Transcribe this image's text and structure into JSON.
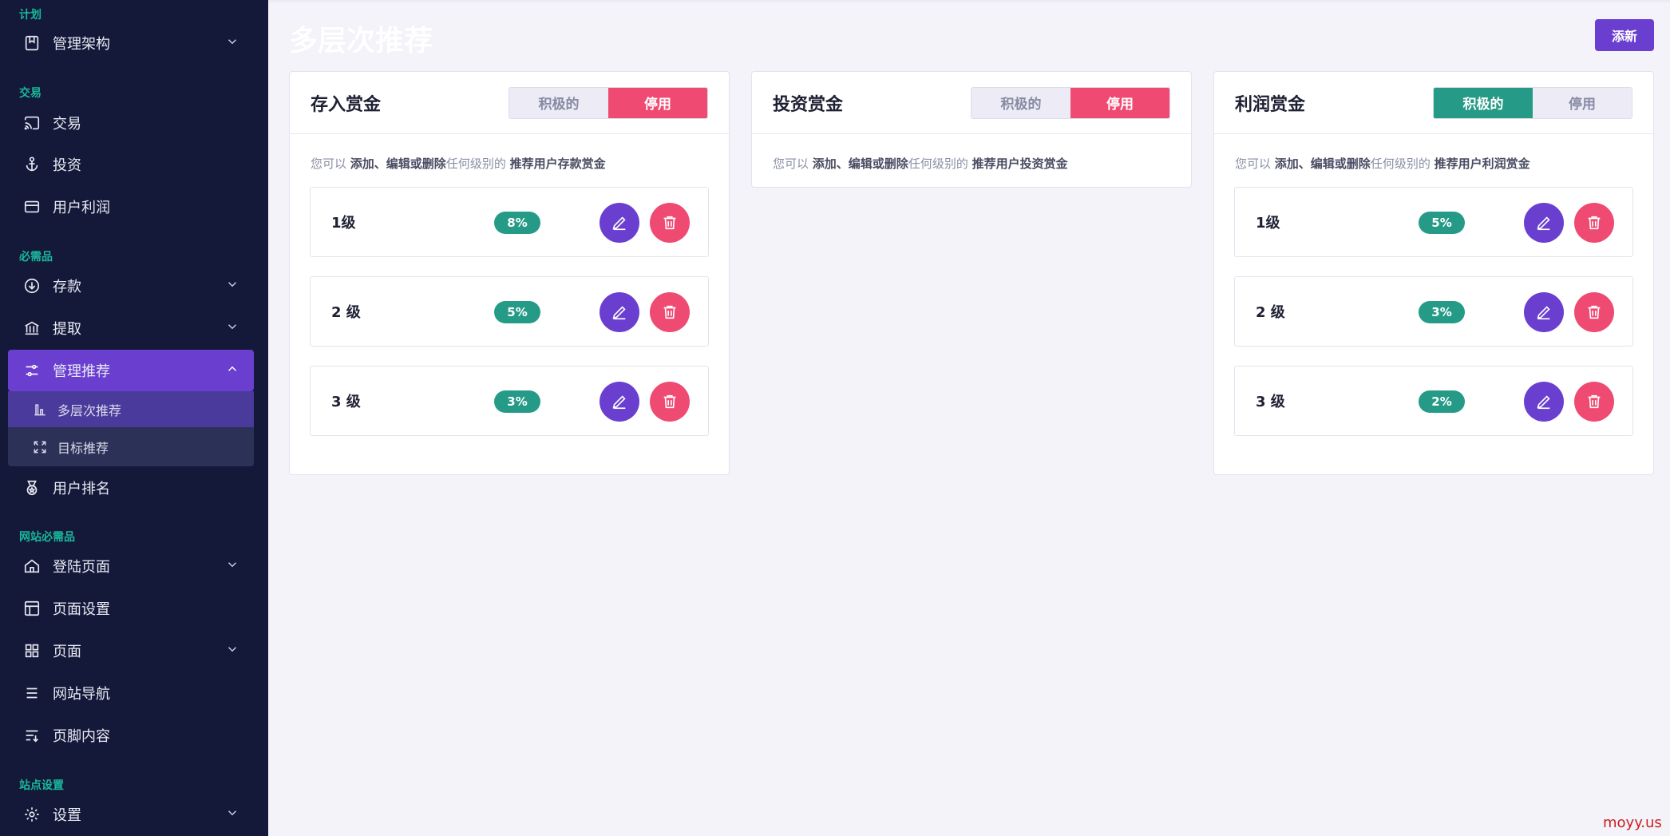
{
  "sidebar": {
    "sections": [
      {
        "label": "计划"
      },
      {
        "label": "交易"
      },
      {
        "label": "必需品"
      },
      {
        "label": "网站必需品"
      },
      {
        "label": "站点设置"
      }
    ],
    "items": [
      {
        "label": "管理架构",
        "icon": "bookmark-box-icon"
      },
      {
        "label": "交易",
        "icon": "cast-icon"
      },
      {
        "label": "投资",
        "icon": "anchor-icon"
      },
      {
        "label": "用户利润",
        "icon": "card-icon"
      },
      {
        "label": "存款",
        "icon": "arrow-down-circle-icon"
      },
      {
        "label": "提取",
        "icon": "bank-icon"
      },
      {
        "label": "管理推荐",
        "icon": "sliders-icon"
      },
      {
        "label": "用户排名",
        "icon": "medal-icon"
      },
      {
        "label": "登陆页面",
        "icon": "home-icon"
      },
      {
        "label": "页面设置",
        "icon": "layout-icon"
      },
      {
        "label": "页面",
        "icon": "grid-icon"
      },
      {
        "label": "网站导航",
        "icon": "menu-icon"
      },
      {
        "label": "页脚内容",
        "icon": "list-icon"
      },
      {
        "label": "设置",
        "icon": "gear-icon"
      }
    ],
    "submenu": [
      {
        "label": "多层次推荐",
        "icon": "bar-chart-icon"
      },
      {
        "label": "目标推荐",
        "icon": "expand-icon"
      }
    ]
  },
  "header": {
    "title": "多层次推荐",
    "add_label": "添新"
  },
  "cards": [
    {
      "title": "存入赏金",
      "toggle": {
        "active": "积极的",
        "inactive": "停用",
        "state": "inactive"
      },
      "desc": {
        "prefix": "您可以",
        "actions": "添加、编辑或删除",
        "middle": "任何级别的",
        "target": "推荐用户存款赏金"
      },
      "levels": [
        {
          "name": "1级",
          "percent": "8%"
        },
        {
          "name": "2 级",
          "percent": "5%"
        },
        {
          "name": "3 级",
          "percent": "3%"
        }
      ]
    },
    {
      "title": "投资赏金",
      "toggle": {
        "active": "积极的",
        "inactive": "停用",
        "state": "inactive"
      },
      "desc": {
        "prefix": "您可以",
        "actions": "添加、编辑或删除",
        "middle": "任何级别的",
        "target": "推荐用户投资赏金"
      },
      "levels": []
    },
    {
      "title": "利润赏金",
      "toggle": {
        "active": "积极的",
        "inactive": "停用",
        "state": "active"
      },
      "desc": {
        "prefix": "您可以",
        "actions": "添加、编辑或删除",
        "middle": "任何级别的",
        "target": "推荐用户利润赏金"
      },
      "levels": [
        {
          "name": "1级",
          "percent": "5%"
        },
        {
          "name": "2 级",
          "percent": "3%"
        },
        {
          "name": "3 级",
          "percent": "2%"
        }
      ]
    }
  ],
  "colors": {
    "sidebar_bg": "#14193a",
    "accent_purple": "#6a3fd0",
    "accent_green": "#259b87",
    "danger_red": "#ee4a72",
    "section_label": "#19b89a"
  },
  "watermark": "moyy.us"
}
